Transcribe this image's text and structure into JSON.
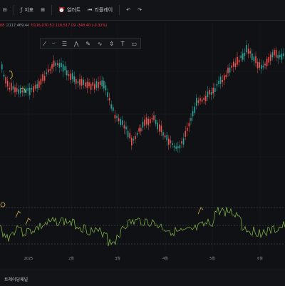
{
  "toolbar": {
    "indicators_label": "지표",
    "alert_label": "얼러트",
    "replay_label": "리플레이"
  },
  "ohlc": {
    "partial": "68",
    "high": "고117,469.44",
    "low": "저116,070.52",
    "close": "116,517.09",
    "change": "-348.40 (-0.32%)"
  },
  "axis": {
    "labels": [
      "2025",
      "2월",
      "3월",
      "4월",
      "5월",
      "6월"
    ]
  },
  "bottom": {
    "panel_label": "트레이딩패널"
  },
  "colors": {
    "up": "#26a69a",
    "down": "#ef5350",
    "indicator": "#8bc34a",
    "annotation": "#f0d058"
  }
}
